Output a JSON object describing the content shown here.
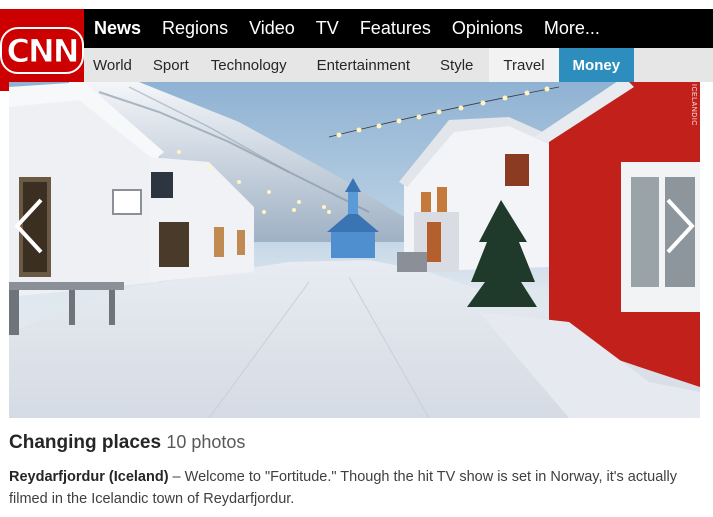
{
  "logo": {
    "text": "CNN"
  },
  "top_nav": {
    "items": [
      "News",
      "Regions",
      "Video",
      "TV",
      "Features",
      "Opinions",
      "More..."
    ]
  },
  "sub_nav": {
    "items": [
      "World",
      "Sport",
      "Technology",
      "Entertainment",
      "Style",
      "Travel",
      "Money"
    ]
  },
  "gallery": {
    "photo_credit": "ICELANDIC",
    "prev_icon": "chevron-left-icon",
    "next_icon": "chevron-right-icon",
    "title": "Changing places",
    "count": "10 photos",
    "location": "Reydarfjordur (Iceland)",
    "dash": " – ",
    "description": "Welcome to \"Fortitude.\" Though the hit TV show is set in Norway, it's actually filmed in the Icelandic town of Reydarfjordur."
  },
  "colors": {
    "brand_red": "#cc0000",
    "nav_black": "#000000",
    "subnav_gray": "#e6e6e6",
    "money_blue": "#2d8ebd"
  }
}
